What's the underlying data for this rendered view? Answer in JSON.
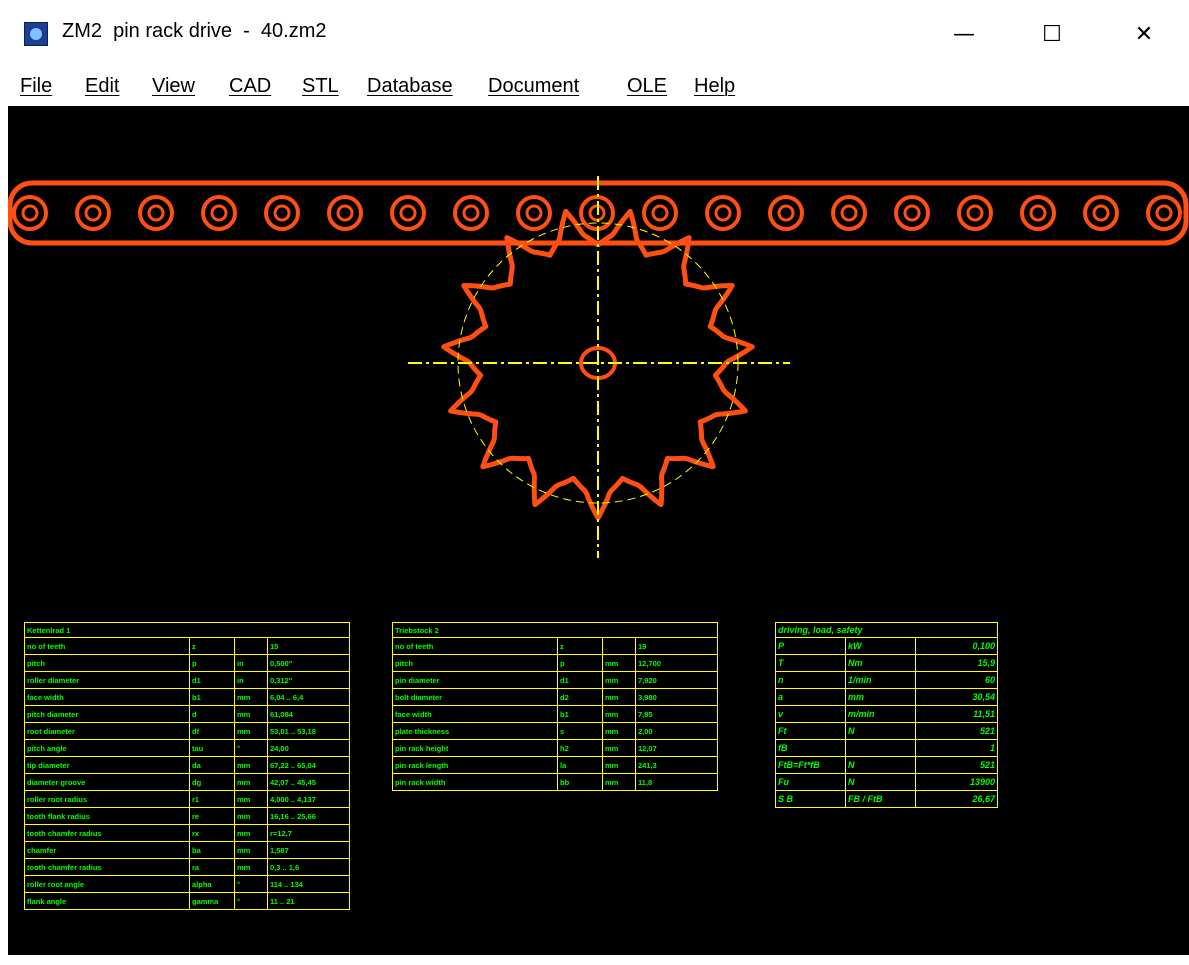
{
  "window": {
    "title": "ZM2  pin rack drive  -  40.zm2",
    "icon": "zm2-gear-app-icon",
    "minimize_glyph": "—",
    "maximize_glyph": "☐",
    "close_glyph": "✕"
  },
  "menu": {
    "items": [
      "File",
      "Edit",
      "View",
      "CAD",
      "STL",
      "Database",
      "Document",
      "OLE",
      "Help"
    ]
  },
  "colors": {
    "canvas_bg": "#000000",
    "gear_outline": "#ff4f12",
    "centerline": "#ffff00",
    "table_lines": "#ffff00",
    "table_text": "#00ff00"
  },
  "drawing": {
    "rack_pin_count": 19,
    "sprocket_teeth": 15
  },
  "tables": {
    "sprocket": {
      "title": "Kettenlrad 1",
      "rows": [
        [
          "no of teeth",
          "z",
          "",
          "15"
        ],
        [
          "pitch",
          "p",
          "in",
          "0,500\""
        ],
        [
          "roller diameter",
          "d1",
          "in",
          "0,312\""
        ],
        [
          "face width",
          "b1",
          "mm",
          "6,04 .. 6,4"
        ],
        [
          "pitch diameter",
          "d",
          "mm",
          "61,084"
        ],
        [
          "root diameter",
          "df",
          "mm",
          "53,01 .. 53,18"
        ],
        [
          "pitch angle",
          "tau",
          "°",
          "24,00"
        ],
        [
          "tip diameter",
          "da",
          "mm",
          "67,22 .. 65,04"
        ],
        [
          "diameter groove",
          "dg",
          "mm",
          "42,07 .. 45,45"
        ],
        [
          "roller root radius",
          "r1",
          "mm",
          "4,000 .. 4,137"
        ],
        [
          "tooth flank radius",
          "re",
          "mm",
          "16,16 .. 25,66"
        ],
        [
          "tooth chamfer radius",
          "rx",
          "mm",
          "r=12,7"
        ],
        [
          "chamfer",
          "ba",
          "mm",
          "1,587"
        ],
        [
          "tooth chamfer radius",
          "ra",
          "mm",
          "0,3 .. 1,6"
        ],
        [
          "roller root angle",
          "alpha",
          "°",
          "114 .. 134"
        ],
        [
          "flank angle",
          "gamma",
          "°",
          "11 .. 21"
        ]
      ]
    },
    "pinrack": {
      "title": "Triebstock 2",
      "rows": [
        [
          "no of teeth",
          "z",
          "",
          "19"
        ],
        [
          "pitch",
          "p",
          "mm",
          "12,700"
        ],
        [
          "pin diameter",
          "d1",
          "mm",
          "7,920"
        ],
        [
          "bolt diameter",
          "d2",
          "mm",
          "3,980"
        ],
        [
          "face width",
          "b1",
          "mm",
          "7,85"
        ],
        [
          "plate thickness",
          "s",
          "mm",
          "2,00"
        ],
        [
          "pin rack height",
          "h2",
          "mm",
          "12,07"
        ],
        [
          "pin rack length",
          "la",
          "mm",
          "241,3"
        ],
        [
          "pin rack width",
          "bb",
          "mm",
          "11,8"
        ]
      ]
    },
    "load": {
      "title": "driving, load, safety",
      "rows": [
        [
          "P",
          "kW",
          "0,100"
        ],
        [
          "T",
          "Nm",
          "15,9"
        ],
        [
          "n",
          "1/min",
          "60"
        ],
        [
          "a",
          "mm",
          "30,54"
        ],
        [
          "v",
          "m/min",
          "11,51"
        ],
        [
          "Ft",
          "N",
          "521"
        ],
        [
          "fB",
          "",
          "1"
        ],
        [
          "FtB=Ft*fB",
          "N",
          "521"
        ],
        [
          "Fu",
          "N",
          "13900"
        ],
        [
          "S B",
          "FB / FtB",
          "26,67"
        ]
      ]
    }
  }
}
